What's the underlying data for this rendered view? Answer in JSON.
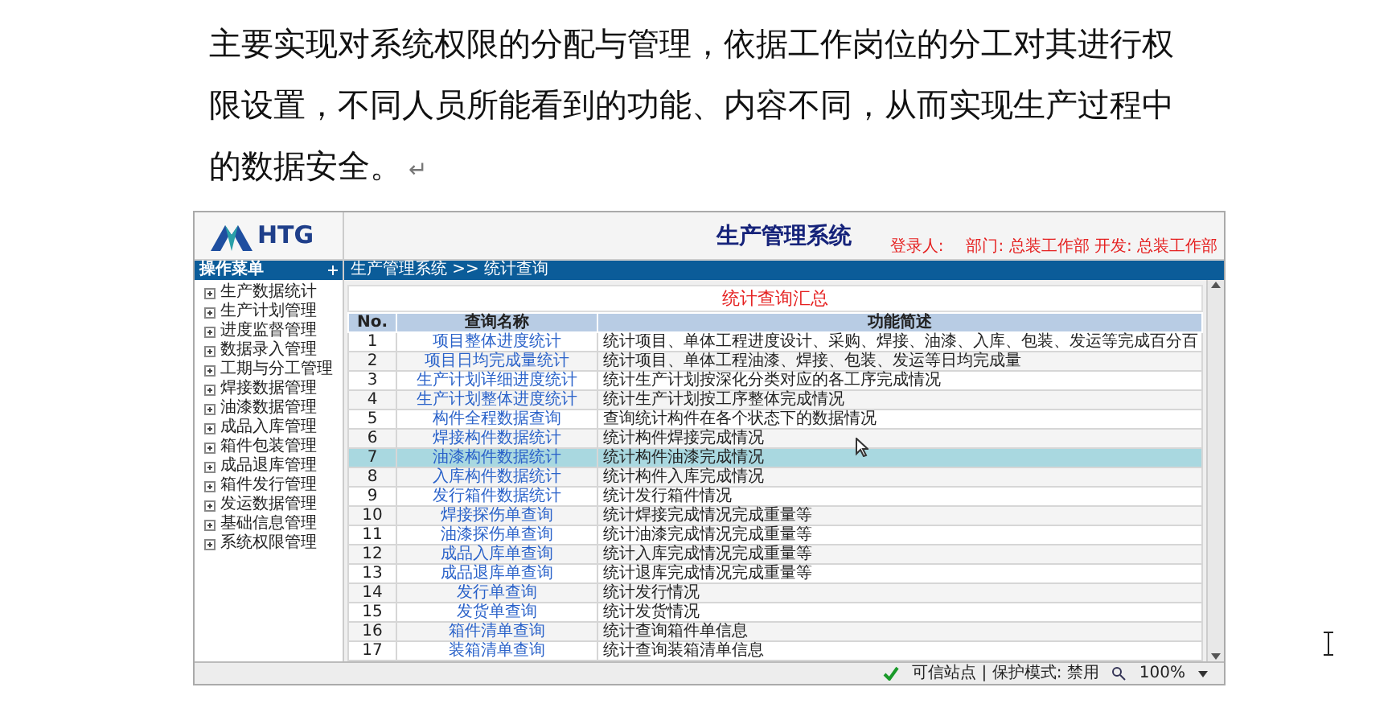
{
  "document": {
    "paragraph": "主要实现对系统权限的分配与管理，依据工作岗位的分工对其进行权限设置，不同人员所能看到的功能、内容不同，从而实现生产过程中的数据安全。",
    "paragraph_mark": "↵"
  },
  "app": {
    "logo": {
      "text": "HTG"
    },
    "title": "生产管理系统",
    "login": {
      "label": "登录人:",
      "dept": "部门: 总装工作部 开发: 总装工作部"
    },
    "menu": {
      "title": "操作菜单",
      "items": [
        {
          "label": "生产数据统计",
          "expanded": false
        },
        {
          "label": "生产计划管理",
          "expanded": false
        },
        {
          "label": "进度监督管理",
          "expanded": false
        },
        {
          "label": "数据录入管理",
          "expanded": false
        },
        {
          "label": "工期与分工管理",
          "expanded": false
        },
        {
          "label": "焊接数据管理",
          "expanded": false
        },
        {
          "label": "油漆数据管理",
          "expanded": false
        },
        {
          "label": "成品入库管理",
          "expanded": false
        },
        {
          "label": "箱件包装管理",
          "expanded": false
        },
        {
          "label": "成品退库管理",
          "expanded": false
        },
        {
          "label": "箱件发行管理",
          "expanded": false
        },
        {
          "label": "发运数据管理",
          "expanded": false
        },
        {
          "label": "基础信息管理",
          "expanded": false
        },
        {
          "label": "系统权限管理",
          "expanded": false
        }
      ]
    },
    "breadcrumb": "生产管理系统 >> 统计查询",
    "report_title": "统计查询汇总",
    "table": {
      "columns": [
        "No.",
        "查询名称",
        "功能简述"
      ],
      "rows": [
        {
          "no": "1",
          "name": "项目整体进度统计",
          "desc": "统计项目、单体工程进度设计、采购、焊接、油漆、入库、包装、发运等完成百分百",
          "selected": false
        },
        {
          "no": "2",
          "name": "项目日均完成量统计",
          "desc": "统计项目、单体工程油漆、焊接、包装、发运等日均完成量",
          "selected": false
        },
        {
          "no": "3",
          "name": "生产计划详细进度统计",
          "desc": "统计生产计划按深化分类对应的各工序完成情况",
          "selected": false
        },
        {
          "no": "4",
          "name": "生产计划整体进度统计",
          "desc": "统计生产计划按工序整体完成情况",
          "selected": false
        },
        {
          "no": "5",
          "name": "构件全程数据查询",
          "desc": "查询统计构件在各个状态下的数据情况",
          "selected": false
        },
        {
          "no": "6",
          "name": "焊接构件数据统计",
          "desc": "统计构件焊接完成情况",
          "selected": false
        },
        {
          "no": "7",
          "name": "油漆构件数据统计",
          "desc": "统计构件油漆完成情况",
          "selected": true
        },
        {
          "no": "8",
          "name": "入库构件数据统计",
          "desc": "统计构件入库完成情况",
          "selected": false
        },
        {
          "no": "9",
          "name": "发行箱件数据统计",
          "desc": "统计发行箱件情况",
          "selected": false
        },
        {
          "no": "10",
          "name": "焊接探伤单查询",
          "desc": "统计焊接完成情况完成重量等",
          "selected": false
        },
        {
          "no": "11",
          "name": "油漆探伤单查询",
          "desc": "统计油漆完成情况完成重量等",
          "selected": false
        },
        {
          "no": "12",
          "name": "成品入库单查询",
          "desc": "统计入库完成情况完成重量等",
          "selected": false
        },
        {
          "no": "13",
          "name": "成品退库单查询",
          "desc": "统计退库完成情况完成重量等",
          "selected": false
        },
        {
          "no": "14",
          "name": "发行单查询",
          "desc": "统计发行情况",
          "selected": false
        },
        {
          "no": "15",
          "name": "发货单查询",
          "desc": "统计发货情况",
          "selected": false
        },
        {
          "no": "16",
          "name": "箱件清单查询",
          "desc": "统计查询箱件单信息",
          "selected": false
        },
        {
          "no": "17",
          "name": "装箱清单查询",
          "desc": "统计查询装箱清单信息",
          "selected": false
        }
      ]
    },
    "status_bar": {
      "zone": "可信站点 | 保护模式: 禁用",
      "zoom": "100%"
    }
  }
}
